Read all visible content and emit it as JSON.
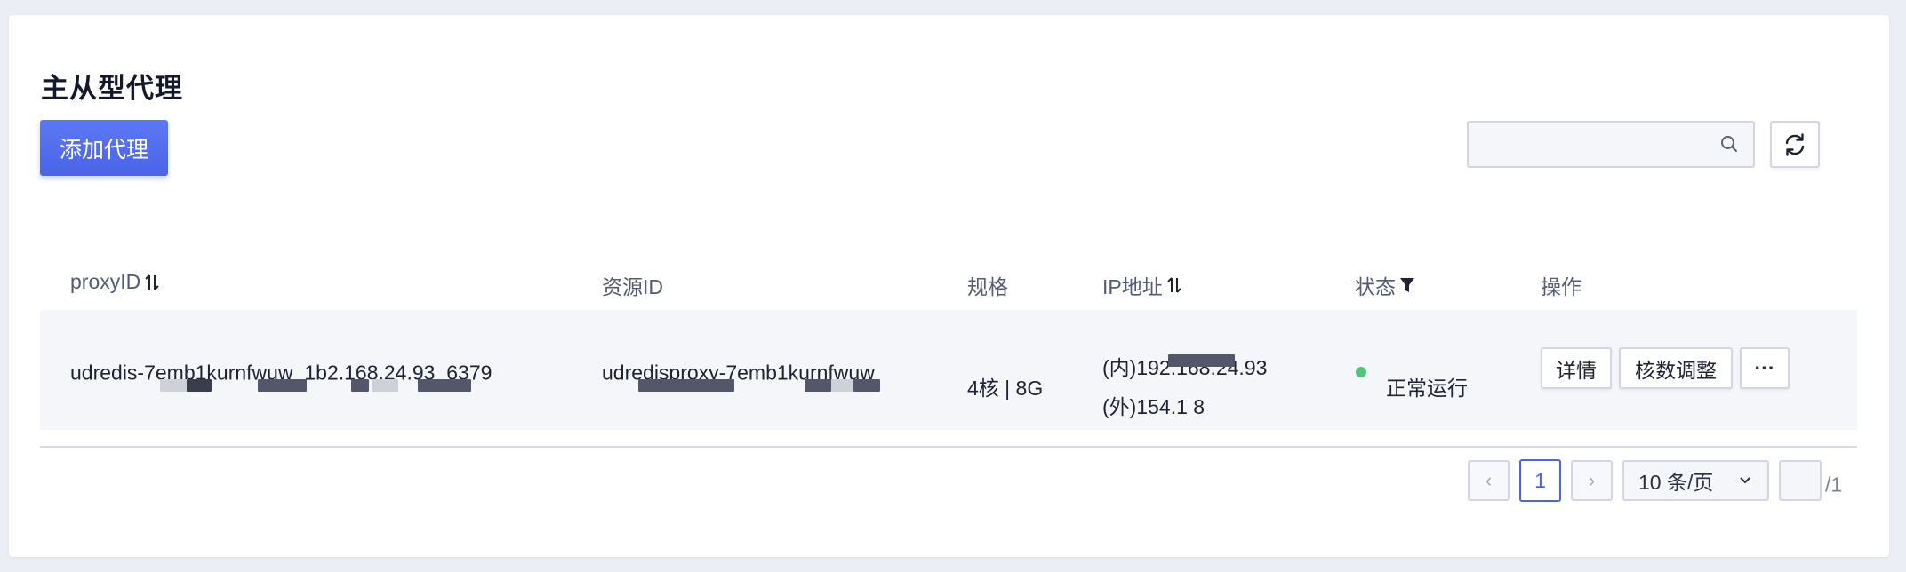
{
  "page_title": "主从型代理",
  "toolbar": {
    "add_label": "添加代理",
    "search_placeholder": "",
    "search_icon": "search-icon",
    "refresh_icon": "refresh-icon"
  },
  "table": {
    "headers": {
      "proxy_id": "proxyID",
      "resource_id": "资源ID",
      "spec": "规格",
      "ip": "IP地址",
      "status": "状态",
      "actions": "操作"
    },
    "rows": [
      {
        "proxy_id": "udredis-7emb1kurnfwuw_1b2.168.24.93_6379",
        "resource_id": "udredisproxy-7emb1kurnfwuw",
        "spec": "4核 | 8G",
        "ip_inner": "(内)192.168.24.93",
        "ip_outer": "(外)154.1      8",
        "status": "正常运行",
        "status_color": "#52c47a",
        "actions": {
          "detail": "详情",
          "resize": "核数调整",
          "more": "···"
        }
      }
    ]
  },
  "pagination": {
    "prev": "‹",
    "current_page": "1",
    "next": "›",
    "page_size": "10 条/页",
    "jump_value": "",
    "total": "/1"
  },
  "colors": {
    "primary": "#4b63e8",
    "status_running": "#52c47a"
  }
}
